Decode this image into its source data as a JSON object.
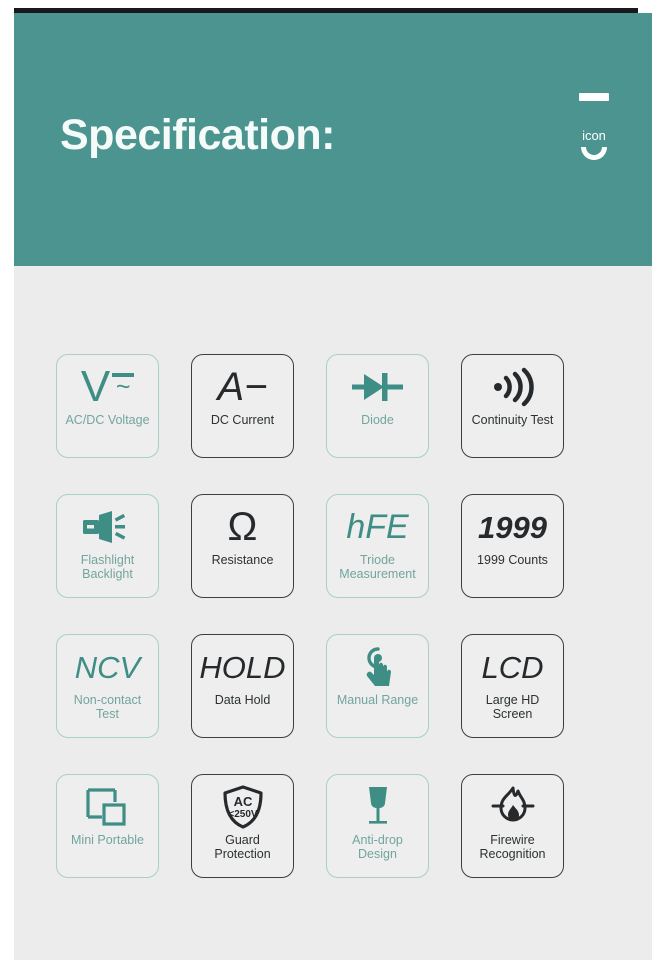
{
  "header": {
    "title": "Specification:",
    "icon_label": "icon",
    "dash_icon": "dash-icon",
    "smile_icon": "u-curve-icon",
    "background_color": "#4b9490",
    "title_color": "#f4fbf9"
  },
  "theme": {
    "page_background": "#ffffff",
    "body_background": "#ececec",
    "teal_accent": "#3f8e86",
    "teal_border": "#a8cfc9",
    "teal_label": "#72a59d",
    "dark_accent": "#262a2c",
    "dark_border": "#3b3f42",
    "tile_background": "#eeeeee"
  },
  "features": [
    {
      "id": "ac-dc-voltage",
      "label": "AC/DC Voltage",
      "symbol": "V≃",
      "icon": "voltage-v-symbol-icon",
      "style": "teal"
    },
    {
      "id": "dc-current",
      "label": "DC Current",
      "symbol": "A−",
      "icon": "dc-current-a-symbol-icon",
      "style": "dark"
    },
    {
      "id": "diode",
      "label": "Diode",
      "symbol": "",
      "icon": "diode-symbol-icon",
      "style": "teal"
    },
    {
      "id": "continuity-test",
      "label": "Continuity Test",
      "symbol": "",
      "icon": "sound-waves-icon",
      "style": "dark"
    },
    {
      "id": "flashlight-backlight",
      "label": "Flashlight\nBacklight",
      "symbol": "",
      "icon": "flashlight-icon",
      "style": "teal"
    },
    {
      "id": "resistance",
      "label": "Resistance",
      "symbol": "Ω",
      "icon": "ohm-symbol-icon",
      "style": "dark"
    },
    {
      "id": "triode-measurement",
      "label": "Triode\nMeasurement",
      "symbol": "hFE",
      "icon": "hfe-text-icon",
      "style": "teal"
    },
    {
      "id": "1999-counts",
      "label": "1999 Counts",
      "symbol": "1999",
      "icon": "counts-number-icon",
      "style": "dark"
    },
    {
      "id": "non-contact-test",
      "label": "Non-contact\nTest",
      "symbol": "NCV",
      "icon": "ncv-text-icon",
      "style": "teal"
    },
    {
      "id": "data-hold",
      "label": "Data Hold",
      "symbol": "HOLD",
      "icon": "hold-text-icon",
      "style": "dark"
    },
    {
      "id": "manual-range",
      "label": "Manual Range",
      "symbol": "",
      "icon": "tap-hand-icon",
      "style": "teal"
    },
    {
      "id": "large-hd-screen",
      "label": "Large HD\nScreen",
      "symbol": "LCD",
      "icon": "lcd-text-icon",
      "style": "dark"
    },
    {
      "id": "mini-portable",
      "label": "Mini Portable",
      "symbol": "",
      "icon": "two-squares-icon",
      "style": "teal"
    },
    {
      "id": "guard-protection",
      "label": "Guard\nProtection",
      "symbol": "",
      "icon": "shield-ac-250v-icon",
      "style": "dark",
      "shield_line1": "AC",
      "shield_line2": "<250V"
    },
    {
      "id": "anti-drop-design",
      "label": "Anti-drop\nDesign",
      "symbol": "",
      "icon": "wine-glass-fragile-icon",
      "style": "teal"
    },
    {
      "id": "firewire-recognition",
      "label": "Firewire\nRecognition",
      "symbol": "",
      "icon": "flame-icon",
      "style": "dark"
    }
  ]
}
